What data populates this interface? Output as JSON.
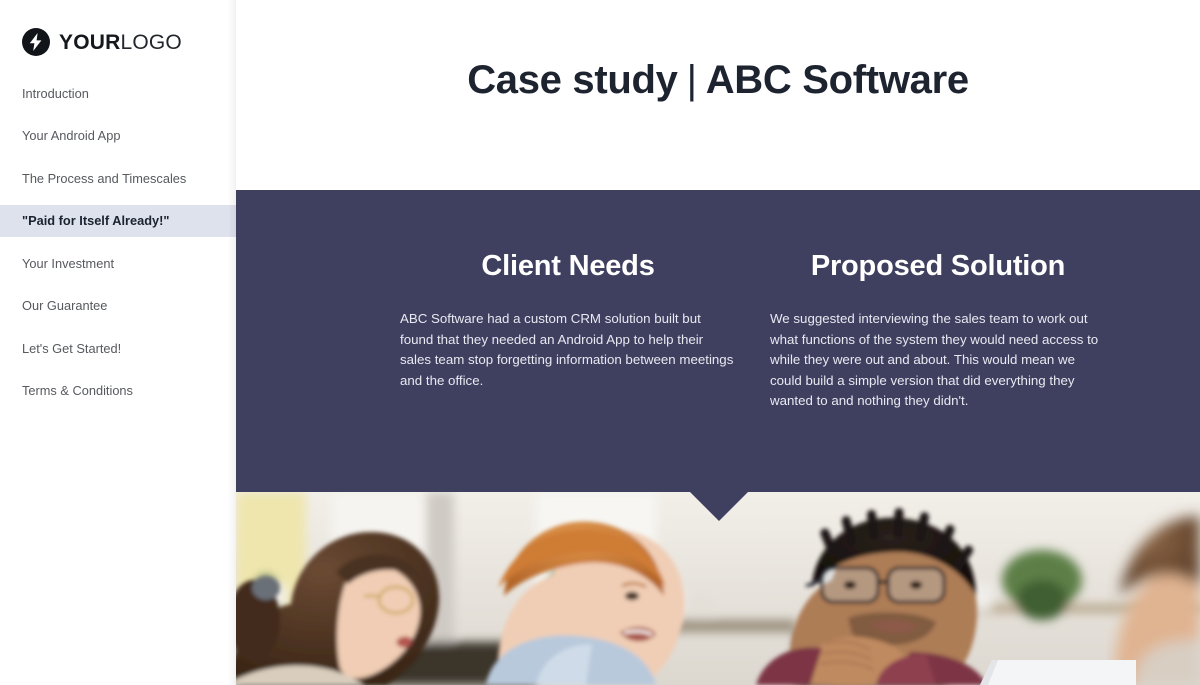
{
  "brand": {
    "logo_bold": "YOUR",
    "logo_light": "LOGO",
    "logo_icon": "lightning-bolt-icon"
  },
  "sidebar": {
    "items": [
      {
        "label": "Introduction",
        "active": false
      },
      {
        "label": "Your Android App",
        "active": false
      },
      {
        "label": "The Process and Timescales",
        "active": false
      },
      {
        "label": "\"Paid for Itself Already!\"",
        "active": true
      },
      {
        "label": "Your Investment",
        "active": false
      },
      {
        "label": "Our Guarantee",
        "active": false
      },
      {
        "label": "Let's Get Started!",
        "active": false
      },
      {
        "label": "Terms & Conditions",
        "active": false
      }
    ]
  },
  "header": {
    "title_left": "Case study",
    "title_separator": "|",
    "title_right": "ABC Software"
  },
  "panel": {
    "background_color": "#3f3f5f",
    "columns": [
      {
        "heading": "Client Needs",
        "body": "ABC Software had a custom CRM solution built but found that they needed an Android App to help their sales team stop forgetting information between meetings and the office."
      },
      {
        "heading": "Proposed Solution",
        "body": "We suggested interviewing the sales team to work out what functions of the system they would need access to while they were out and about. This would mean we could build a simple version that did everything they wanted to and nothing they didn't."
      }
    ]
  },
  "photo": {
    "alt": "Four colleagues having a meeting around a table with a laptop",
    "name": "meeting-photo"
  },
  "colors": {
    "accent": "#3f3f5f",
    "active_nav_bg": "#dee2ec",
    "title_text": "#1d2430",
    "nav_text": "#56595e"
  }
}
